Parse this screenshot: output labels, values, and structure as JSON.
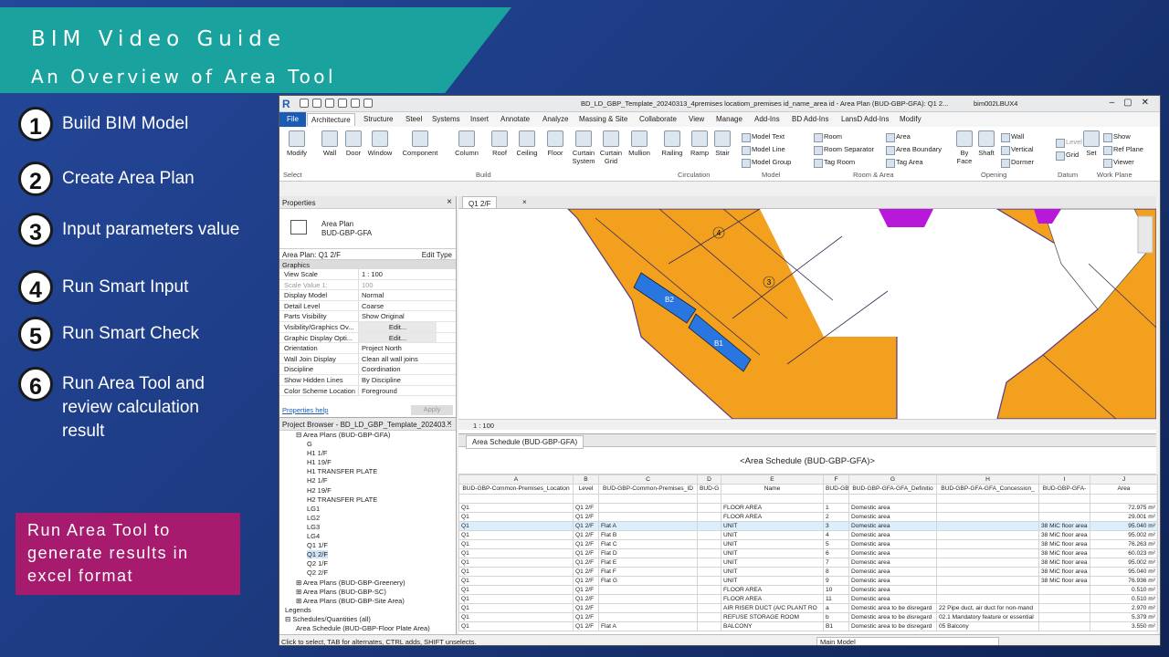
{
  "banner": {
    "title": "BIM Video Guide",
    "subtitle": "An Overview of Area Tool"
  },
  "steps": [
    {
      "num": "1",
      "text": "Build BIM Model"
    },
    {
      "num": "2",
      "text": "Create Area Plan"
    },
    {
      "num": "3",
      "text": "Input parameters value"
    },
    {
      "num": "4",
      "text": "Run Smart Input"
    },
    {
      "num": "5",
      "text": "Run Smart Check"
    },
    {
      "num": "6",
      "text": "Run Area Tool and review calculation result"
    }
  ],
  "note": "Run Area Tool to generate results in excel format",
  "app": {
    "logo": "R",
    "title": "BD_LD_GBP_Template_20240313_4premises locatiom_premises id_name_area id - Area Plan (BUD-GBP-GFA): Q1 2...",
    "user": "bim002LBUX4",
    "tabs": [
      "File",
      "Architecture",
      "Structure",
      "Steel",
      "Systems",
      "Insert",
      "Annotate",
      "Analyze",
      "Massing & Site",
      "Collaborate",
      "View",
      "Manage",
      "Add-Ins",
      "BD Add-Ins",
      "LansD Add-Ins",
      "Modify"
    ],
    "ribbon": {
      "modify": "Modify",
      "select": "Select",
      "build_tools": [
        "Wall",
        "Door",
        "Window",
        "Component",
        "Column",
        "Roof",
        "Ceiling",
        "Floor",
        "Curtain System",
        "Curtain Grid",
        "Mullion"
      ],
      "build_label": "Build",
      "circulation_tools": [
        "Railing",
        "Ramp",
        "Stair"
      ],
      "circulation_label": "Circulation",
      "model_tools": [
        "Model Text",
        "Model Line",
        "Model Group"
      ],
      "model_label": "Model",
      "room_tools": [
        "Room",
        "Room Separator",
        "Tag Room",
        "Area",
        "Area Boundary",
        "Tag Area"
      ],
      "room_label": "Room & Area",
      "opening_tools": [
        "By Face",
        "Shaft",
        "Wall",
        "Vertical",
        "Dormer"
      ],
      "opening_label": "Opening",
      "datum_tools": [
        "Level",
        "Grid"
      ],
      "datum_label": "Datum",
      "workplane_tools": [
        "Set",
        "Show",
        "Ref Plane",
        "Viewer"
      ],
      "workplane_label": "Work Plane"
    },
    "properties": {
      "header": "Properties",
      "type1": "Area Plan",
      "type2": "BUD-GBP-GFA",
      "selector": "Area Plan: Q1 2/F",
      "edit_type": "Edit Type",
      "group": "Graphics",
      "rows": [
        {
          "k": "View Scale",
          "v": "1 : 100"
        },
        {
          "k": "Scale Value    1:",
          "v": "100"
        },
        {
          "k": "Display Model",
          "v": "Normal"
        },
        {
          "k": "Detail Level",
          "v": "Coarse"
        },
        {
          "k": "Parts Visibility",
          "v": "Show Original"
        },
        {
          "k": "Visibility/Graphics Ov...",
          "v": "Edit..."
        },
        {
          "k": "Graphic Display Opti...",
          "v": "Edit..."
        },
        {
          "k": "Orientation",
          "v": "Project North"
        },
        {
          "k": "Wall Join Display",
          "v": "Clean all wall joins"
        },
        {
          "k": "Discipline",
          "v": "Coordination"
        },
        {
          "k": "Show Hidden Lines",
          "v": "By Discipline"
        },
        {
          "k": "Color Scheme Location",
          "v": "Foreground"
        }
      ],
      "help": "Properties help",
      "apply": "Apply"
    },
    "browser": {
      "header": "Project Browser - BD_LD_GBP_Template_202403...",
      "items": [
        {
          "t": "Area Plans (BUD-GBP-GFA)",
          "lvl": 1,
          "exp": "⊟"
        },
        {
          "t": "G",
          "lvl": 2
        },
        {
          "t": "H1 1/F",
          "lvl": 2
        },
        {
          "t": "H1 19/F",
          "lvl": 2
        },
        {
          "t": "H1 TRANSFER PLATE",
          "lvl": 2
        },
        {
          "t": "H2 1/F",
          "lvl": 2
        },
        {
          "t": "H2 19/F",
          "lvl": 2
        },
        {
          "t": "H2 TRANSFER PLATE",
          "lvl": 2
        },
        {
          "t": "LG1",
          "lvl": 2
        },
        {
          "t": "LG2",
          "lvl": 2
        },
        {
          "t": "LG3",
          "lvl": 2
        },
        {
          "t": "LG4",
          "lvl": 2
        },
        {
          "t": "Q1 1/F",
          "lvl": 2
        },
        {
          "t": "Q1 2/F",
          "lvl": 2,
          "sel": true
        },
        {
          "t": "Q2 1/F",
          "lvl": 2
        },
        {
          "t": "Q2 2/F",
          "lvl": 2
        },
        {
          "t": "Area Plans (BUD-GBP-Greenery)",
          "lvl": 1,
          "exp": "⊞"
        },
        {
          "t": "Area Plans (BUD-GBP-SC)",
          "lvl": 1,
          "exp": "⊞"
        },
        {
          "t": "Area Plans (BUD-GBP-Site Area)",
          "lvl": 1,
          "exp": "⊞"
        },
        {
          "t": "Legends",
          "lvl": 0,
          "exp": ""
        },
        {
          "t": "Schedules/Quantities (all)",
          "lvl": 0,
          "exp": "⊟"
        },
        {
          "t": "Area Schedule (BUD-GBP-Floor Plate Area)",
          "lvl": 1
        }
      ]
    },
    "view": {
      "tab": "Q1 2/F",
      "scale": "1 : 100",
      "labels": [
        "4",
        "3",
        "B2",
        "B1"
      ]
    },
    "schedule": {
      "tab": "Area Schedule (BUD-GBP-GFA)",
      "title": "<Area Schedule (BUD-GBP-GFA)>",
      "letters": [
        "A",
        "B",
        "C",
        "D",
        "E",
        "F",
        "G",
        "H",
        "I",
        "J"
      ],
      "headers": [
        "BUD-GBP-Common-Premises_Location",
        "Level",
        "BUD-GBP-Common-Premises_ID",
        "BUD-G",
        "Name",
        "BUD-GB",
        "BUD-GBP-GFA-GFA_Definitio",
        "BUD-GBP-GFA-GFA_Concession_",
        "BUD-GBP-GFA-",
        "Area"
      ],
      "rows": [
        [
          "",
          "",
          "",
          "",
          "",
          "",
          "",
          "",
          "",
          ""
        ],
        [
          "Q1",
          "Q1 2/F",
          "",
          "",
          "FLOOR AREA",
          "1",
          "Domestic area",
          "",
          "",
          "72.975 m²"
        ],
        [
          "Q1",
          "Q1 2/F",
          "",
          "",
          "FLOOR AREA",
          "2",
          "Domestic area",
          "",
          "",
          "29.001 m²"
        ],
        [
          "Q1",
          "Q1 2/F",
          "Flat A",
          "",
          "UNIT",
          "3",
          "Domestic area",
          "",
          "38 MiC floor area",
          "95.040 m²"
        ],
        [
          "Q1",
          "Q1 2/F",
          "Flat B",
          "",
          "UNIT",
          "4",
          "Domestic area",
          "",
          "38 MiC floor area",
          "95.002 m²"
        ],
        [
          "Q1",
          "Q1 2/F",
          "Flat C",
          "",
          "UNIT",
          "5",
          "Domestic area",
          "",
          "38 MiC floor area",
          "76.263 m²"
        ],
        [
          "Q1",
          "Q1 2/F",
          "Flat D",
          "",
          "UNIT",
          "6",
          "Domestic area",
          "",
          "38 MiC floor area",
          "60.023 m²"
        ],
        [
          "Q1",
          "Q1 2/F",
          "Flat E",
          "",
          "UNIT",
          "7",
          "Domestic area",
          "",
          "38 MiC floor area",
          "95.002 m²"
        ],
        [
          "Q1",
          "Q1 2/F",
          "Flat F",
          "",
          "UNIT",
          "8",
          "Domestic area",
          "",
          "38 MiC floor area",
          "95.040 m²"
        ],
        [
          "Q1",
          "Q1 2/F",
          "Flat G",
          "",
          "UNIT",
          "9",
          "Domestic area",
          "",
          "38 MiC floor area",
          "76.936 m²"
        ],
        [
          "Q1",
          "Q1 2/F",
          "",
          "",
          "FLOOR AREA",
          "10",
          "Domestic area",
          "",
          "",
          "0.510 m²"
        ],
        [
          "Q1",
          "Q1 2/F",
          "",
          "",
          "FLOOR AREA",
          "11",
          "Domestic area",
          "",
          "",
          "0.510 m²"
        ],
        [
          "Q1",
          "Q1 2/F",
          "",
          "",
          "AIR RISER DUCT (A/C PLANT RO",
          "a",
          "Domestic area to be disregard",
          "22 Pipe duct, air duct for non-mand",
          "",
          "2.970 m²"
        ],
        [
          "Q1",
          "Q1 2/F",
          "",
          "",
          "REFUSE STORAGE ROOM",
          "b",
          "Domestic area to be disregard",
          "02.1 Mandatory feature or essential",
          "",
          "5.379 m²"
        ],
        [
          "Q1",
          "Q1 2/F",
          "Flat A",
          "",
          "BALCONY",
          "B1",
          "Domestic area to be disregard",
          "05 Balcony",
          "",
          "3.550 m²"
        ]
      ]
    },
    "statusbar": {
      "text": "Click to select, TAB for alternates, CTRL adds, SHIFT unselects.",
      "model": "Main Model"
    }
  }
}
